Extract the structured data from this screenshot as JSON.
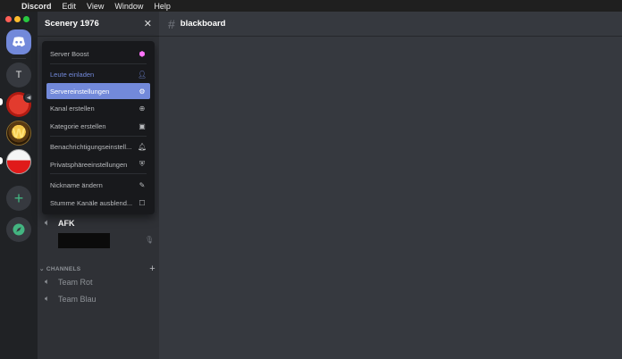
{
  "menubar": {
    "app": "Discord",
    "items": [
      "Edit",
      "View",
      "Window",
      "Help"
    ]
  },
  "rail": {
    "servers": [
      {
        "name": "home",
        "label": ""
      },
      {
        "name": "server-t",
        "label": "T"
      },
      {
        "name": "server-wow",
        "label": "W"
      }
    ],
    "add_icon": "+",
    "explore_icon": "compass-icon"
  },
  "server": {
    "name": "Scenery 1976",
    "close_icon": "✕"
  },
  "menu": {
    "items": [
      {
        "label": "Server Boost",
        "icon": "boost-icon"
      },
      {
        "label": "Leute einladen",
        "icon": "add-person-icon"
      },
      {
        "label": "Servereinstellungen",
        "icon": "gear-icon"
      },
      {
        "label": "Kanal erstellen",
        "icon": "plus-circle-icon"
      },
      {
        "label": "Kategorie erstellen",
        "icon": "folder-plus-icon"
      },
      {
        "label": "Benachrichtigungseinstell...",
        "icon": "bell-icon"
      },
      {
        "label": "Privatsphäreeinstellungen",
        "icon": "shield-icon"
      },
      {
        "label": "Nickname ändern",
        "icon": "pencil-icon"
      },
      {
        "label": "Stumme Kanäle ausblend...",
        "icon": "checkbox-icon"
      }
    ]
  },
  "channels": {
    "afk": "AFK",
    "category": "CHANNELS",
    "voice": [
      "Team Rot",
      "Team Blau"
    ]
  },
  "main": {
    "hash": "#",
    "channel": "blackboard"
  },
  "colors": {
    "accent": "#7289da",
    "boost": "#ff73fa",
    "add_green": "#43b581"
  }
}
